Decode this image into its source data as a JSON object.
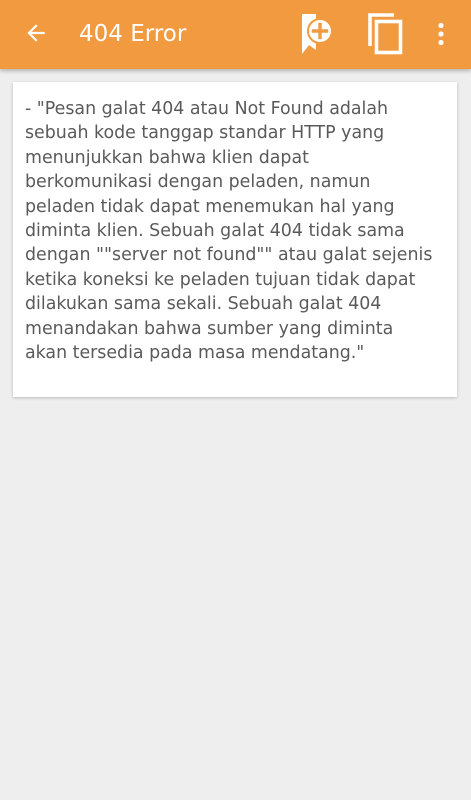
{
  "toolbar": {
    "title": "404 Error",
    "background_color": "#f29a40",
    "icons": {
      "back": "arrow-left-icon",
      "bookmark_add": "bookmark-add-icon",
      "copy": "copy-icon",
      "more": "more-vertical-icon"
    }
  },
  "content": {
    "definition": "- \"Pesan galat 404 atau Not Found adalah\nsebuah kode tanggap standar HTTP yang\nmenunjukkan bahwa klien dapat\nberkomunikasi dengan peladen, namun\npeladen tidak dapat menemukan hal yang\ndiminta klien. Sebuah galat 404 tidak sama\ndengan \"\"server not found\"\" atau galat sejenis\nketika koneksi ke peladen tujuan tidak dapat\ndilakukan sama sekali. Sebuah galat 404\nmenandakan bahwa sumber yang diminta\nakan tersedia pada masa mendatang.\""
  }
}
